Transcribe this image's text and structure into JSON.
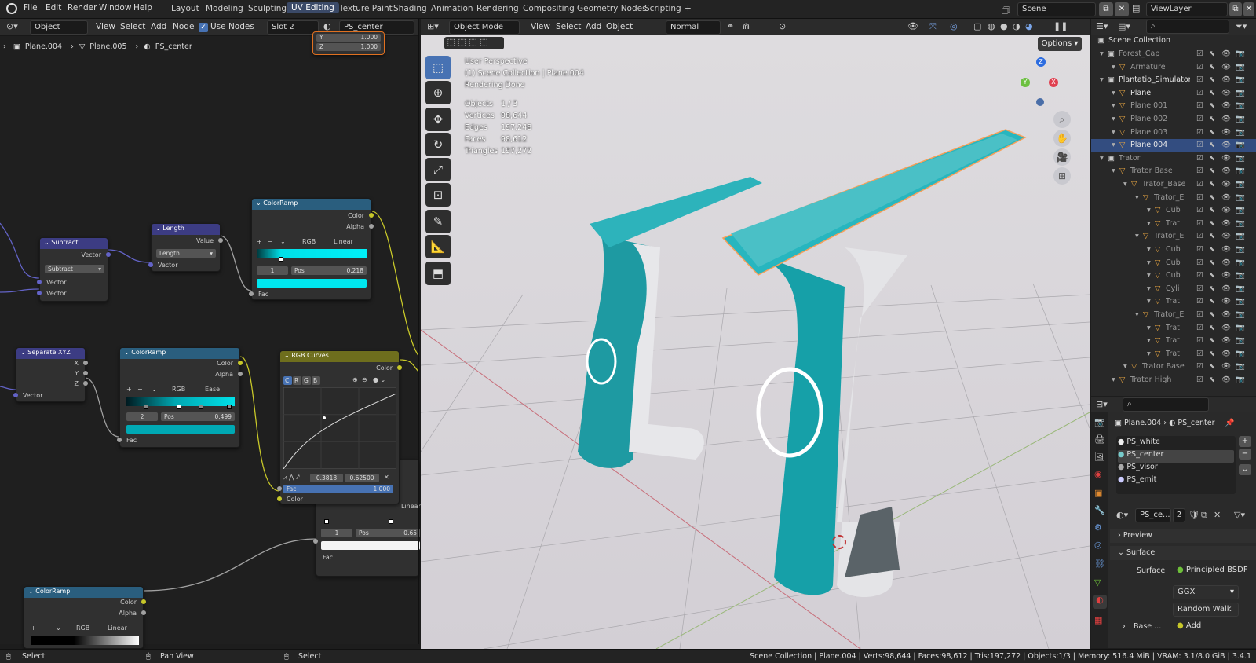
{
  "topbar": {
    "menus": [
      "File",
      "Edit",
      "Render",
      "Window",
      "Help"
    ],
    "workspaces": [
      "Layout",
      "Modeling",
      "Sculpting",
      "UV Editing",
      "Texture Paint",
      "Shading",
      "Animation",
      "Rendering",
      "Compositing",
      "Geometry Nodes",
      "Scripting"
    ],
    "active_workspace": "UV Editing",
    "add_tab": "+",
    "scene": "Scene",
    "view_layer": "ViewLayer"
  },
  "node_editor": {
    "object_type": "Object",
    "menus": [
      "View",
      "Select",
      "Add",
      "Node"
    ],
    "use_nodes": "Use Nodes",
    "slot": "Slot 2",
    "material": "PS_center",
    "breadcrumb": [
      "Plane.004",
      "Plane.005",
      "PS_center"
    ],
    "partial_node": {
      "y_label": "Y",
      "y_val": "1.000",
      "z_label": "Z",
      "z_val": "1.000"
    },
    "subtract": {
      "title": "Subtract",
      "out": "Vector",
      "op": "Subtract",
      "in1": "Vector",
      "in2": "Vector"
    },
    "length": {
      "title": "Length",
      "out": "Value",
      "op": "Length",
      "in": "Vector"
    },
    "colorramp1": {
      "title": "ColorRamp",
      "out1": "Color",
      "out2": "Alpha",
      "mode": "RGB",
      "interp": "Linear",
      "idx": "1",
      "pos_label": "Pos",
      "pos": "0.218",
      "fac": "Fac"
    },
    "separate": {
      "title": "Separate XYZ",
      "x": "X",
      "y": "Y",
      "z": "Z",
      "in": "Vector"
    },
    "colorramp2": {
      "title": "ColorRamp",
      "out1": "Color",
      "out2": "Alpha",
      "mode": "RGB",
      "interp": "Ease",
      "idx": "2",
      "pos_label": "Pos",
      "pos": "0.499",
      "fac": "Fac"
    },
    "rgbcurves": {
      "title": "RGB Curves",
      "out": "Color",
      "channels": [
        "C",
        "R",
        "G",
        "B"
      ],
      "x": "0.3818",
      "y": "0.62500",
      "fac_label": "Fac",
      "fac": "1.000",
      "in": "Color"
    },
    "hidden_ramp": {
      "idx": "1",
      "pos_label": "Pos",
      "pos": "0.65",
      "interp": "Linear",
      "fac": "Fac"
    },
    "colorramp3": {
      "title": "ColorRamp",
      "out1": "Color",
      "out2": "Alpha",
      "mode": "RGB",
      "interp": "Linear"
    }
  },
  "viewport": {
    "mode": "Object Mode",
    "menus": [
      "View",
      "Select",
      "Add",
      "Object"
    ],
    "orientation": "Normal",
    "options": "Options",
    "info_lines": [
      "User Perspective",
      "(1) Scene Collection | Plane.004",
      "Rendering Done"
    ],
    "stats": [
      {
        "label": "Objects",
        "value": "1 / 3"
      },
      {
        "label": "Vertices",
        "value": "98,644"
      },
      {
        "label": "Edges",
        "value": "197,248"
      },
      {
        "label": "Faces",
        "value": "98,612"
      },
      {
        "label": "Triangles",
        "value": "197,272"
      }
    ],
    "gizmo": {
      "x": "X",
      "y": "Y",
      "z": "Z"
    }
  },
  "outliner": {
    "root": "Scene Collection",
    "rows": [
      {
        "label": "Forest_Cap",
        "indent": 1,
        "dim": true
      },
      {
        "label": "Armature",
        "indent": 2,
        "dim": true
      },
      {
        "label": "Plantatio_Simulator",
        "indent": 1,
        "dim": false
      },
      {
        "label": "Plane",
        "indent": 2,
        "dim": false
      },
      {
        "label": "Plane.001",
        "indent": 2,
        "dim": true
      },
      {
        "label": "Plane.002",
        "indent": 2,
        "dim": true
      },
      {
        "label": "Plane.003",
        "indent": 2,
        "dim": true
      },
      {
        "label": "Plane.004",
        "indent": 2,
        "dim": false,
        "sel": true
      },
      {
        "label": "Trator",
        "indent": 1,
        "dim": true
      },
      {
        "label": "Trator Base",
        "indent": 2,
        "dim": true
      },
      {
        "label": "Trator_Base",
        "indent": 3,
        "dim": true
      },
      {
        "label": "Trator_E",
        "indent": 4,
        "dim": true
      },
      {
        "label": "Cub",
        "indent": 5,
        "dim": true
      },
      {
        "label": "Trat",
        "indent": 5,
        "dim": true
      },
      {
        "label": "Trator_E",
        "indent": 4,
        "dim": true
      },
      {
        "label": "Cub",
        "indent": 5,
        "dim": true
      },
      {
        "label": "Cub",
        "indent": 5,
        "dim": true
      },
      {
        "label": "Cub",
        "indent": 5,
        "dim": true
      },
      {
        "label": "Cyli",
        "indent": 5,
        "dim": true
      },
      {
        "label": "Trat",
        "indent": 5,
        "dim": true
      },
      {
        "label": "Trator_E",
        "indent": 4,
        "dim": true
      },
      {
        "label": "Trat",
        "indent": 5,
        "dim": true
      },
      {
        "label": "Trat",
        "indent": 5,
        "dim": true
      },
      {
        "label": "Trat",
        "indent": 5,
        "dim": true
      },
      {
        "label": "Trator Base",
        "indent": 3,
        "dim": true
      },
      {
        "label": "Trator High",
        "indent": 2,
        "dim": true
      }
    ]
  },
  "properties": {
    "breadcrumb_obj": "Plane.004",
    "breadcrumb_mat": "PS_center",
    "slots": [
      "PS_white",
      "PS_center",
      "PS_visor",
      "PS_emit"
    ],
    "active_slot": "PS_center",
    "mat_name": "PS_ce...",
    "users": "2",
    "preview": "Preview",
    "surface_panel": "Surface",
    "surface_label": "Surface",
    "surface_value": "Principled BSDF",
    "distribution": "GGX",
    "subsurface": "Random Walk",
    "base_label": "Base ...",
    "base_value": "Add"
  },
  "statusbar": {
    "left1": "Select",
    "left2": "Pan View",
    "left3": "Select",
    "right": "Scene Collection | Plane.004 | Verts:98,644 | Faces:98,612 | Tris:197,272 | Objects:1/3 | Memory: 516.4 MiB | VRAM: 3.1/8.0 GiB | 3.4.1"
  }
}
